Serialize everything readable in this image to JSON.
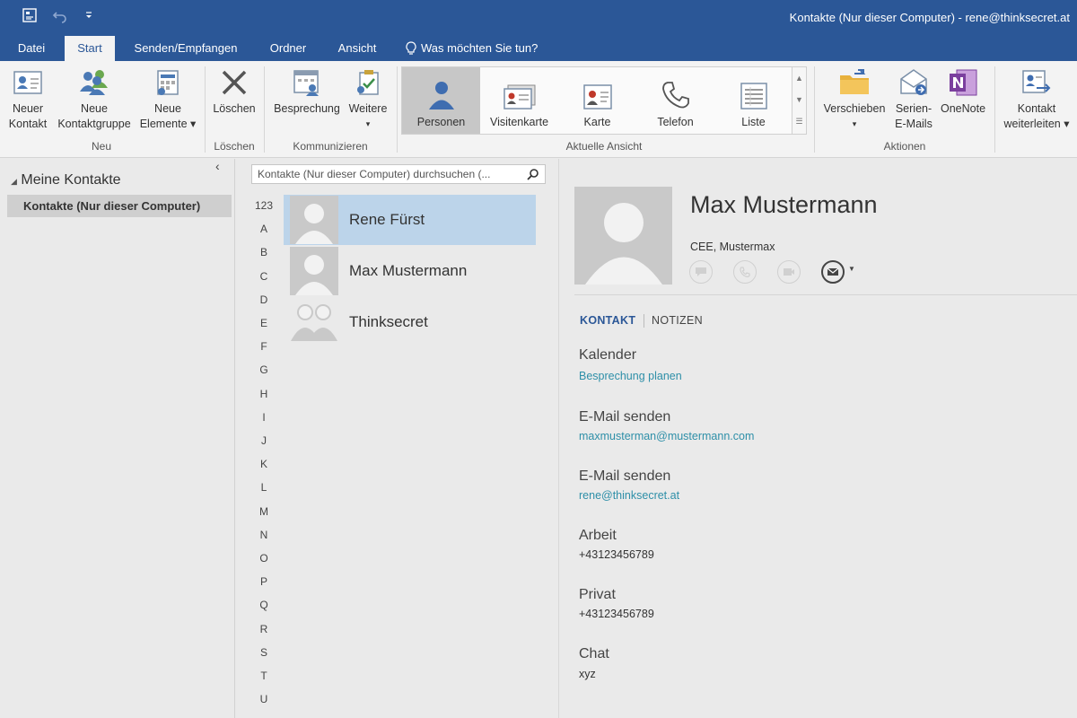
{
  "window": {
    "title": "Kontakte (Nur dieser Computer) - rene@thinksecret.at",
    "quick_access": [
      "view-icon",
      "undo-icon",
      "customize-icon"
    ]
  },
  "tabs": [
    {
      "label": "Datei"
    },
    {
      "label": "Start",
      "active": true
    },
    {
      "label": "Senden/Empfangen"
    },
    {
      "label": "Ordner"
    },
    {
      "label": "Ansicht"
    }
  ],
  "tell_me": "Was möchten Sie tun?",
  "ribbon": {
    "neu": {
      "label": "Neu",
      "buttons": [
        {
          "line1": "Neuer",
          "line2": "Kontakt",
          "icon": "contact-card-icon"
        },
        {
          "line1": "Neue",
          "line2": "Kontaktgruppe",
          "icon": "contact-group-icon"
        },
        {
          "line1": "Neue",
          "line2": "Elemente ▾",
          "icon": "new-items-icon"
        }
      ]
    },
    "loeschen": {
      "label": "Löschen",
      "buttons": [
        {
          "line1": "Löschen",
          "icon": "delete-icon"
        }
      ]
    },
    "kommunizieren": {
      "label": "Kommunizieren",
      "buttons": [
        {
          "line1": "Besprechung",
          "icon": "meeting-icon"
        },
        {
          "line1": "Weitere",
          "line2": "▾",
          "icon": "more-icon"
        }
      ]
    },
    "aktuelle_ansicht": {
      "label": "Aktuelle Ansicht",
      "items": [
        {
          "label": "Personen",
          "selected": true,
          "icon": "person-icon"
        },
        {
          "label": "Visitenkarte",
          "icon": "business-card-icon"
        },
        {
          "label": "Karte",
          "icon": "card-icon"
        },
        {
          "label": "Telefon",
          "icon": "phone-icon"
        },
        {
          "label": "Liste",
          "icon": "list-icon"
        }
      ]
    },
    "aktionen": {
      "label": "Aktionen",
      "buttons": [
        {
          "line1": "Verschieben",
          "line2": "▾",
          "icon": "folder-move-icon"
        },
        {
          "line1": "Serien-",
          "line2": "E-Mails",
          "icon": "mail-merge-icon"
        },
        {
          "line1": "OneNote",
          "icon": "onenote-icon"
        },
        {
          "line1": "Kontakt",
          "line2": "weiterleiten ▾",
          "icon": "forward-contact-icon"
        }
      ]
    }
  },
  "nav": {
    "group": "Meine Kontakte",
    "selected": "Kontakte (Nur dieser Computer)"
  },
  "list": {
    "search_placeholder": "Kontakte (Nur dieser Computer) durchsuchen (...",
    "index": [
      "123",
      "A",
      "B",
      "C",
      "D",
      "E",
      "F",
      "G",
      "H",
      "I",
      "J",
      "K",
      "L",
      "M",
      "N",
      "O",
      "P",
      "Q",
      "R",
      "S",
      "T",
      "U"
    ],
    "contacts": [
      {
        "name": "Rene Fürst",
        "selected": true
      },
      {
        "name": "Max Mustermann",
        "selected": false
      },
      {
        "name": "Thinksecret",
        "selected": false,
        "group": true
      }
    ]
  },
  "detail": {
    "name": "Max Mustermann",
    "company": "CEE, Mustermax",
    "tabs": [
      "KONTAKT",
      "NOTIZEN"
    ],
    "sections": [
      {
        "label": "Kalender",
        "value": "Besprechung planen",
        "link": true
      },
      {
        "label": "E-Mail senden",
        "value": "maxmusterman@mustermann.com",
        "link": true
      },
      {
        "label": "E-Mail senden",
        "value": "rene@thinksecret.at",
        "link": true
      },
      {
        "label": "Arbeit",
        "value": "+43123456789",
        "link": false
      },
      {
        "label": "Privat",
        "value": "+43123456789",
        "link": false
      },
      {
        "label": "Chat",
        "value": "xyz",
        "link": false
      }
    ]
  },
  "colors": {
    "accent": "#2b5797",
    "link": "#2e8fa8",
    "selection": "#bcd4ea"
  }
}
